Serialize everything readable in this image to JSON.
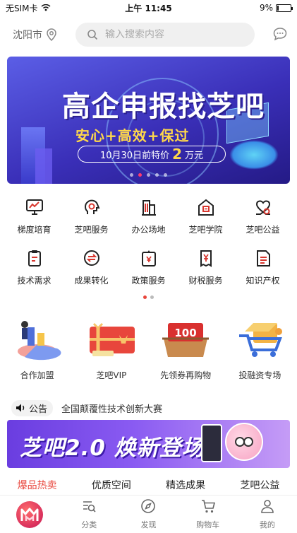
{
  "status_bar": {
    "carrier": "无SIM卡",
    "time": "上午 11:45",
    "battery": "9%",
    "battery_level": 0.09
  },
  "header": {
    "city": "沈阳市",
    "search_placeholder": "输入搜索内容"
  },
  "banner": {
    "title": "高企申报找芝吧",
    "subtitle": "安心+高效+保过",
    "price_prefix": "10月30日前特价",
    "price_value": "2",
    "price_unit": "万元",
    "slide_count": 5,
    "active_slide": 1
  },
  "categories": [
    [
      {
        "label": "梯度培育",
        "icon": "chart-monitor-icon"
      },
      {
        "label": "芝吧服务",
        "icon": "service-head-icon"
      },
      {
        "label": "办公场地",
        "icon": "building-icon"
      },
      {
        "label": "芝吧学院",
        "icon": "school-icon"
      },
      {
        "label": "芝吧公益",
        "icon": "charity-icon"
      }
    ],
    [
      {
        "label": "技术需求",
        "icon": "clipboard-icon"
      },
      {
        "label": "成果转化",
        "icon": "exchange-icon"
      },
      {
        "label": "政策服务",
        "icon": "policy-doc-icon"
      },
      {
        "label": "财税服务",
        "icon": "tax-icon"
      },
      {
        "label": "知识产权",
        "icon": "ip-doc-icon"
      }
    ]
  ],
  "grid_pages": {
    "count": 2,
    "active": 0
  },
  "features": [
    {
      "label": "合作加盟",
      "icon": "partner-chart-icon"
    },
    {
      "label": "芝吧VIP",
      "icon": "vip-gift-icon"
    },
    {
      "label": "先领券再购物",
      "icon": "coupon-icon",
      "coupon_value": "100"
    },
    {
      "label": "投融资专场",
      "icon": "investment-cart-icon"
    }
  ],
  "notice": {
    "tag": "公告",
    "text": "全国颠覆性技术创新大赛"
  },
  "promo": {
    "text": "芝吧2.0 焕新登场"
  },
  "tabs": [
    {
      "label": "爆品热卖",
      "active": true
    },
    {
      "label": "优质空间",
      "active": false
    },
    {
      "label": "精选成果",
      "active": false
    },
    {
      "label": "芝吧公益",
      "active": false
    }
  ],
  "bottom_nav": [
    {
      "label": "",
      "icon": "home-logo-icon"
    },
    {
      "label": "分类",
      "icon": "category-icon"
    },
    {
      "label": "发现",
      "icon": "compass-icon"
    },
    {
      "label": "购物车",
      "icon": "cart-icon"
    },
    {
      "label": "我的",
      "icon": "user-icon"
    }
  ],
  "colors": {
    "accent": "#e8463c",
    "banner_start": "#5b5ee6",
    "banner_end": "#241a86",
    "promo_start": "#6a3de0"
  }
}
